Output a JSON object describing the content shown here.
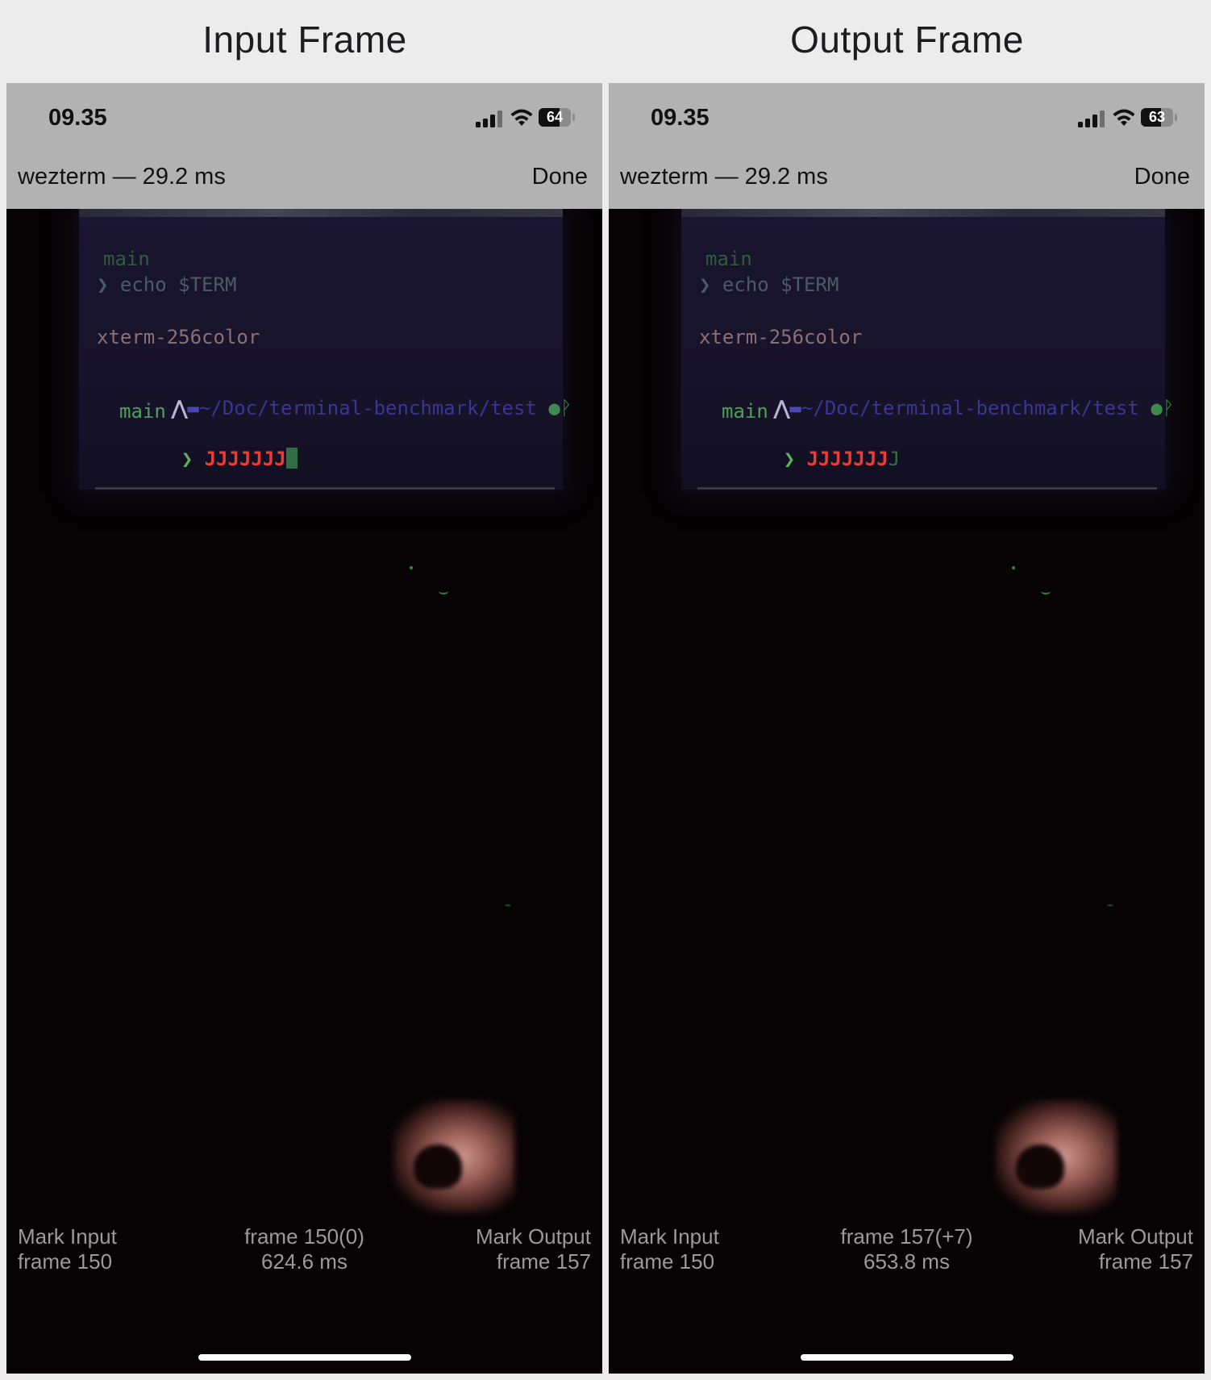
{
  "headings": {
    "left": "Input Frame",
    "right": "Output Frame"
  },
  "panels": [
    {
      "status": {
        "time": "09.35",
        "battery_percent": "64",
        "battery_level": 0.64,
        "signal_bars": 3
      },
      "nav": {
        "title": "wezterm — 29.2 ms",
        "done_label": "Done"
      },
      "terminal": {
        "line_main_top": "main",
        "line_echo": "❯ echo $TERM",
        "line_xterm": "xterm-256color",
        "path": "~/Doc/terminal-benchmark/test",
        "line_main_branch": "main",
        "prompt_chevron": "❯",
        "prompt_cmd": "JJJJJJJ",
        "cursor_char": ""
      },
      "footer": {
        "mark_input_label": "Mark Input",
        "mark_input_frame": "frame 150",
        "center_frame": "frame 150(0)",
        "center_time": "624.6 ms",
        "mark_output_label": "Mark Output",
        "mark_output_frame": "frame 157"
      }
    },
    {
      "status": {
        "time": "09.35",
        "battery_percent": "63",
        "battery_level": 0.63,
        "signal_bars": 3
      },
      "nav": {
        "title": "wezterm — 29.2 ms",
        "done_label": "Done"
      },
      "terminal": {
        "line_main_top": "main",
        "line_echo": "❯ echo $TERM",
        "line_xterm": "xterm-256color",
        "path": "~/Doc/terminal-benchmark/test",
        "line_main_branch": "main",
        "prompt_chevron": "❯",
        "prompt_cmd": "JJJJJJJ",
        "cursor_char": "J"
      },
      "footer": {
        "mark_input_label": "Mark Input",
        "mark_input_frame": "frame 150",
        "center_frame": "frame 157(+7)",
        "center_time": "653.8 ms",
        "mark_output_label": "Mark Output",
        "mark_output_frame": "frame 157"
      }
    }
  ]
}
